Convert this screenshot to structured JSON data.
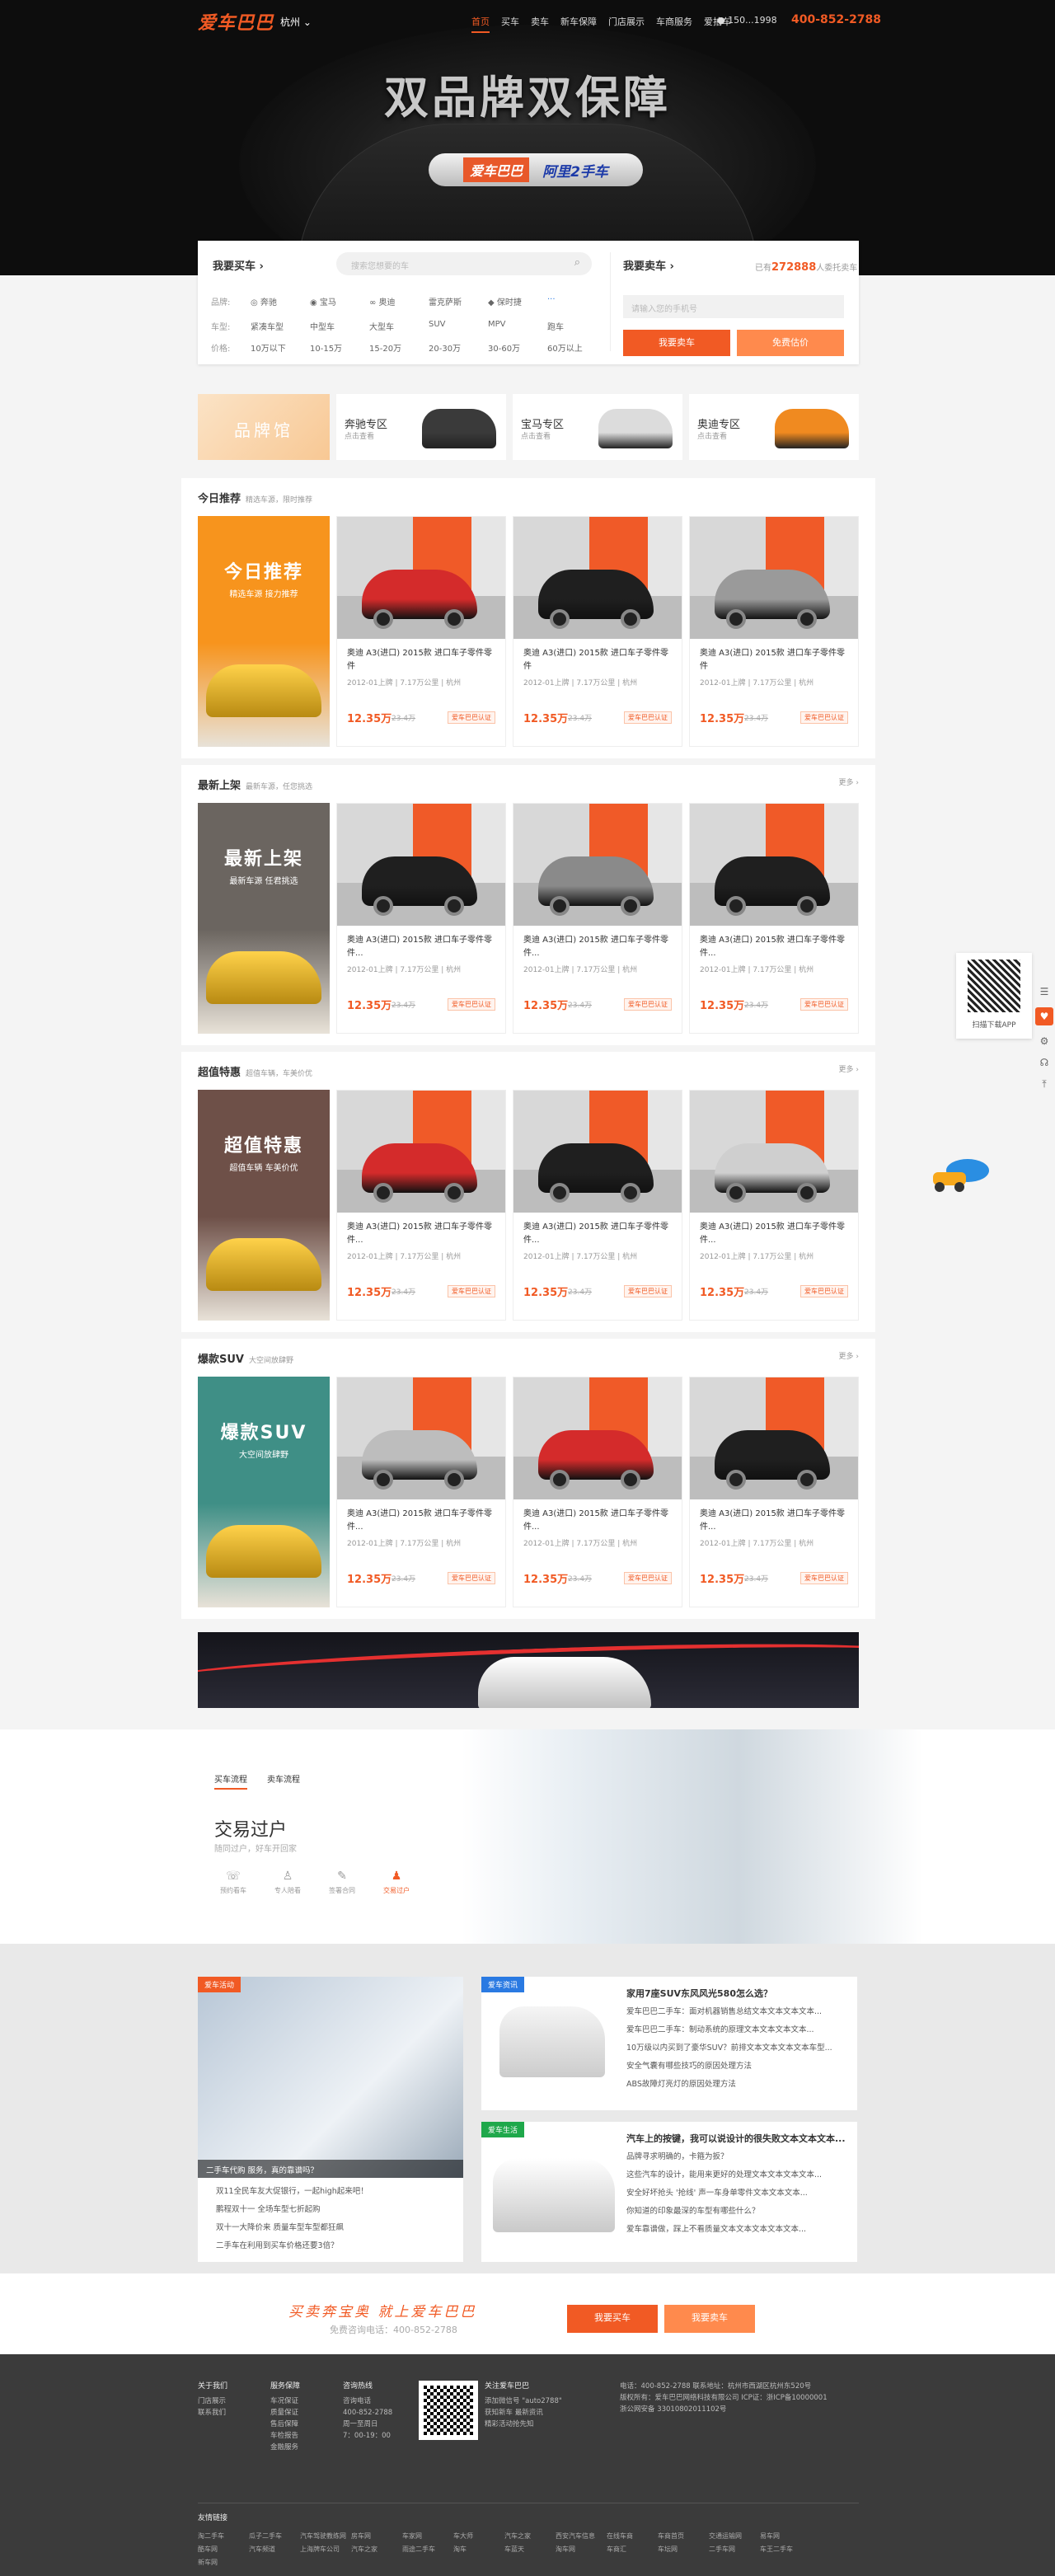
{
  "header": {
    "logo": "爱车巴巴",
    "city": "杭州",
    "nav": [
      "首页",
      "买车",
      "卖车",
      "新车保障",
      "门店展示",
      "车商服务",
      "爱拍车"
    ],
    "user": "150...1998",
    "hotline": "400-852-2788"
  },
  "hero": {
    "slogan": "双品牌双保障",
    "brand_a": "爱车巴巴",
    "brand_b": "阿里2手车"
  },
  "search": {
    "buy_title": "我要买车 ›",
    "search_placeholder": "搜索您想要的车",
    "sell_title": "我要卖车 ›",
    "sell_count_prefix": "已有",
    "sell_count": "272888",
    "sell_count_suffix": "人委托卖车",
    "brand_label": "品牌:",
    "brands": [
      "奔驰",
      "宝马",
      "奥迪",
      "雷克萨斯",
      "保时捷",
      "···"
    ],
    "type_label": "车型:",
    "types": [
      "紧凑车型",
      "中型车",
      "大型车",
      "SUV",
      "MPV",
      "跑车"
    ],
    "price_label": "价格:",
    "prices": [
      "10万以下",
      "10-15万",
      "15-20万",
      "20-30万",
      "30-60万",
      "60万以上"
    ],
    "phone_placeholder": "请输入您的手机号",
    "sell_btn": "我要卖车",
    "eval_btn": "免费估价"
  },
  "brand_row": {
    "title": "品牌馆",
    "items": [
      {
        "name": "奔驰专区",
        "sub": "点击查看",
        "color": "#3a3a3a"
      },
      {
        "name": "宝马专区",
        "sub": "点击查看",
        "color": "#dcdcdc"
      },
      {
        "name": "奥迪专区",
        "sub": "点击查看",
        "color": "#f08a20"
      }
    ]
  },
  "sections": [
    {
      "title": "今日推荐",
      "sub": "精选车源，限时推荐",
      "more": "",
      "promo_title": "今日推荐",
      "promo_sub": "精选车源  接力推荐",
      "promo_color": "#f7941d",
      "cars": [
        {
          "title": "奥迪 A3(进口) 2015款 进口车子零件零件",
          "meta": "2012-01上牌 | 7.17万公里 | 杭州",
          "price": "12.35万",
          "old": "23.4万",
          "tag": "爱车巴巴认证",
          "color": "#d42b2b"
        },
        {
          "title": "奥迪 A3(进口) 2015款 进口车子零件零件",
          "meta": "2012-01上牌 | 7.17万公里 | 杭州",
          "price": "12.35万",
          "old": "23.4万",
          "tag": "爱车巴巴认证",
          "color": "#1f1f1f"
        },
        {
          "title": "奥迪 A3(进口) 2015款 进口车子零件零件",
          "meta": "2012-01上牌 | 7.17万公里 | 杭州",
          "price": "12.35万",
          "old": "23.4万",
          "tag": "爱车巴巴认证",
          "color": "#9a9a9a"
        }
      ]
    },
    {
      "title": "最新上架",
      "sub": "最新车源，任您挑选",
      "more": "更多 ›",
      "promo_title": "最新上架",
      "promo_sub": "最新车源  任君挑选",
      "promo_color": "#6b6560",
      "cars": [
        {
          "title": "奥迪 A3(进口) 2015款 进口车子零件零件...",
          "meta": "2012-01上牌 | 7.17万公里 | 杭州",
          "price": "12.35万",
          "old": "23.4万",
          "tag": "爱车巴巴认证",
          "color": "#1f1f1f"
        },
        {
          "title": "奥迪 A3(进口) 2015款 进口车子零件零件...",
          "meta": "2012-01上牌 | 7.17万公里 | 杭州",
          "price": "12.35万",
          "old": "23.4万",
          "tag": "爱车巴巴认证",
          "color": "#8a8a8a"
        },
        {
          "title": "奥迪 A3(进口) 2015款 进口车子零件零件...",
          "meta": "2012-01上牌 | 7.17万公里 | 杭州",
          "price": "12.35万",
          "old": "23.4万",
          "tag": "爱车巴巴认证",
          "color": "#1f1f1f"
        }
      ]
    },
    {
      "title": "超值特惠",
      "sub": "超值车辆，车美价优",
      "more": "更多 ›",
      "promo_title": "超值特惠",
      "promo_sub": "超值车辆  车美价优",
      "promo_color": "#6e5048",
      "cars": [
        {
          "title": "奥迪 A3(进口) 2015款 进口车子零件零件...",
          "meta": "2012-01上牌 | 7.17万公里 | 杭州",
          "price": "12.35万",
          "old": "23.4万",
          "tag": "爱车巴巴认证",
          "color": "#d42b2b"
        },
        {
          "title": "奥迪 A3(进口) 2015款 进口车子零件零件...",
          "meta": "2012-01上牌 | 7.17万公里 | 杭州",
          "price": "12.35万",
          "old": "23.4万",
          "tag": "爱车巴巴认证",
          "color": "#1f1f1f"
        },
        {
          "title": "奥迪 A3(进口) 2015款 进口车子零件零件...",
          "meta": "2012-01上牌 | 7.17万公里 | 杭州",
          "price": "12.35万",
          "old": "23.4万",
          "tag": "爱车巴巴认证",
          "color": "#cfcfcf"
        }
      ]
    },
    {
      "title": "爆款SUV",
      "sub": "大空间放肆野",
      "more": "更多 ›",
      "promo_title": "爆款SUV",
      "promo_sub": "大空间放肆野",
      "promo_color": "#3f8f86",
      "cars": [
        {
          "title": "奥迪 A3(进口) 2015款 进口车子零件零件...",
          "meta": "2012-01上牌 | 7.17万公里 | 杭州",
          "price": "12.35万",
          "old": "23.4万",
          "tag": "爱车巴巴认证",
          "color": "#bdbdbd"
        },
        {
          "title": "奥迪 A3(进口) 2015款 进口车子零件零件...",
          "meta": "2012-01上牌 | 7.17万公里 | 杭州",
          "price": "12.35万",
          "old": "23.4万",
          "tag": "爱车巴巴认证",
          "color": "#d42b2b"
        },
        {
          "title": "奥迪 A3(进口) 2015款 进口车子零件零件...",
          "meta": "2012-01上牌 | 7.17万公里 | 杭州",
          "price": "12.35万",
          "old": "23.4万",
          "tag": "爱车巴巴认证",
          "color": "#1f1f1f"
        }
      ]
    }
  ],
  "trade": {
    "tabs": [
      "买车流程",
      "卖车流程"
    ],
    "title": "交易过户",
    "sub": "随同过户，好车开回家",
    "steps": [
      "预约看车",
      "专人陪看",
      "签署合同",
      "交易过户"
    ]
  },
  "news": {
    "activity_tag": "爱车活动",
    "activity_caption": "二手车代购 服务，真的靠谱吗？",
    "activity_list": [
      "双11全民车友大促银行，一起high起来吧！",
      "鹏程双十一 全场车型七折起购",
      "双十一大降价来 质量车型车型都狂飙",
      "二手车在利用到买车价格还要3倍？"
    ],
    "info_tag": "爱车资讯",
    "info_list": [
      "家用7座SUV东风风光580怎么选？",
      "爱车巴巴二手车：面对机器销售总结文本文本文本文本...",
      "爱车巴巴二手车：制动系统的原理文本文本文本文本...",
      "10万级以内买到了豪华SUV？前排文本文本文本文本车型...",
      "安全气囊有哪些技巧的原因处理方法",
      "ABS故障灯亮灯的原因处理方法"
    ],
    "life_tag": "爱车生活",
    "life_list": [
      "汽车上的按键，我可以说设计的很失败文本文本文本...",
      "品牌寻求明确的，卡箍为扳？",
      "这些汽车的设计，能用来更好的处理文本文本文本文本...",
      "安全好坏抢头 '抢线' 声一车身单零件文本文本文本...",
      "你知道的印象最深的车型有哪些什么？",
      "爱车靠谱做，踩上不看质量文本文本文本文本文本..."
    ]
  },
  "cta": {
    "slogan": "买卖奔宝奥  就上爱车巴巴",
    "phone": "免费咨询电话：400-852-2788",
    "buy_btn": "我要买车",
    "sell_btn": "我要卖车"
  },
  "footer": {
    "cols": [
      {
        "h": "关于我们",
        "items": [
          "门店展示",
          "联系我们"
        ]
      },
      {
        "h": "服务保障",
        "items": [
          "车况保证",
          "质量保证",
          "售后保障",
          "车检报告",
          "金融服务"
        ]
      },
      {
        "h": "咨询热线",
        "items": [
          "咨询电话",
          "400-852-2788",
          "周一至周日",
          "7：00-19：00"
        ]
      }
    ],
    "follow": {
      "h": "关注爱车巴巴",
      "items": [
        "添加微信号 \"auto2788\"",
        "获知新车 最新资讯",
        "精彩活动抢先知"
      ]
    },
    "contact": [
      "电话：400-852-2788    联系地址：杭州市西湖区杭州东520号",
      "版权所有：爱车巴巴网络科技有限公司    ICP证：浙ICP备10000001",
      "浙公网安备 33010802011102号"
    ],
    "links_title": "友情链接",
    "links": [
      "淘二手车",
      "瓜子二手车",
      "汽车驾驶教练网",
      "房车网",
      "车家网",
      "车大师",
      "汽车之家",
      "西安汽车信息",
      "在线车商",
      "车商首页",
      "交通运输网",
      "易车网",
      "酷车网",
      "汽车频道",
      "上海牌车公司",
      "汽车之家",
      "雨途二手车",
      "淘车",
      "车蓝天",
      "淘车网",
      "车商汇",
      "车坛网",
      "二手车网",
      "车王二手车",
      "新车网"
    ]
  },
  "side": {
    "scan_text": "扫描下载APP"
  }
}
